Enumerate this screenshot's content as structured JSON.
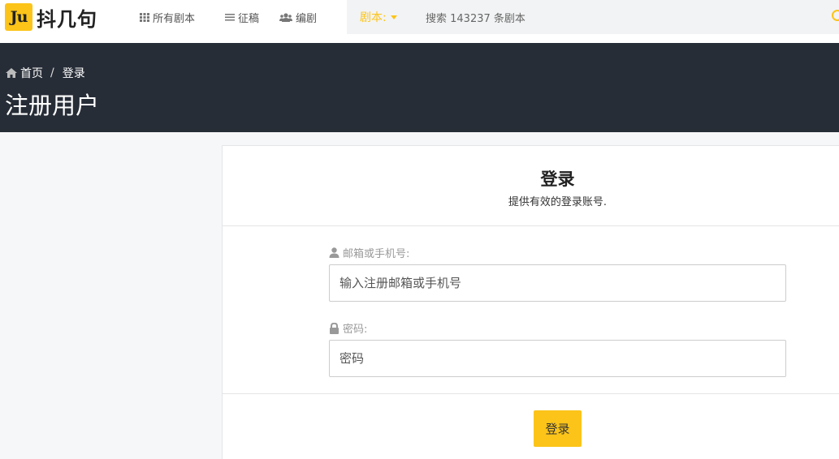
{
  "navbar": {
    "logo_badge": "Ju",
    "logo_text": "抖几句",
    "links": [
      {
        "label": "所有剧本",
        "icon": "grid-icon"
      },
      {
        "label": "征稿",
        "icon": "list-icon"
      },
      {
        "label": "编剧",
        "icon": "users-icon"
      }
    ],
    "dropdown_label": "剧本:",
    "search_text": "搜索 143237 条剧本"
  },
  "header": {
    "breadcrumb": {
      "home": "首页",
      "current": "登录"
    },
    "title": "注册用户"
  },
  "login_card": {
    "title": "登录",
    "subtitle": "提供有效的登录账号.",
    "email_label": "邮箱或手机号:",
    "email_placeholder": "输入注册邮箱或手机号",
    "password_label": "密码:",
    "password_placeholder": "密码",
    "submit_label": "登录"
  },
  "colors": {
    "accent": "#fcc419",
    "header_bg": "#272d37",
    "page_bg": "#f6f7f8"
  }
}
